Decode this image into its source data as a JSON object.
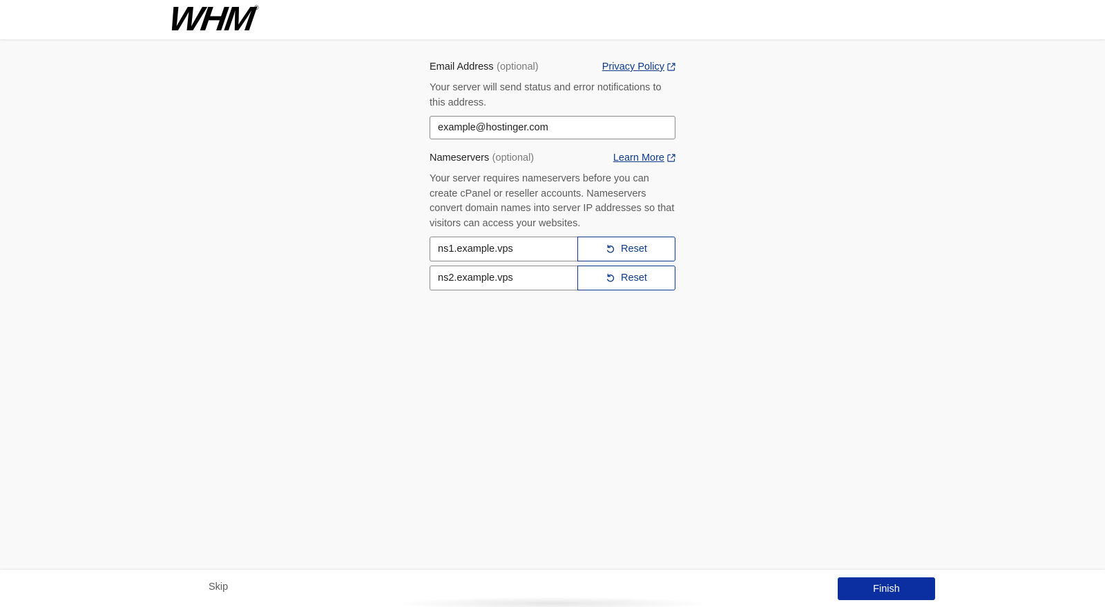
{
  "header": {
    "logo_text": "WHM",
    "logo_mark": "®"
  },
  "email": {
    "label": "Email Address",
    "optional": "(optional)",
    "link_label": "Privacy Policy",
    "link_icon": "external-link-icon",
    "help": "Your server will send status and error notifications to this address.",
    "value": "example@hostinger.com"
  },
  "nameservers": {
    "label": "Nameservers",
    "optional": "(optional)",
    "link_label": "Learn More",
    "link_icon": "external-link-icon",
    "help": "Your server requires nameservers before you can create cPanel or reseller accounts. Nameservers convert domain names into server IP addresses so that visitors can access your websites.",
    "rows": [
      {
        "value": "ns1.example.vps",
        "reset_label": "Reset",
        "reset_icon": "undo-icon"
      },
      {
        "value": "ns2.example.vps",
        "reset_label": "Reset",
        "reset_icon": "undo-icon"
      }
    ]
  },
  "footer": {
    "skip_label": "Skip",
    "finish_label": "Finish"
  },
  "colors": {
    "accent": "#0b3a8c",
    "primary_button": "#0b2fa0",
    "page_bg": "#f9f9fa"
  }
}
